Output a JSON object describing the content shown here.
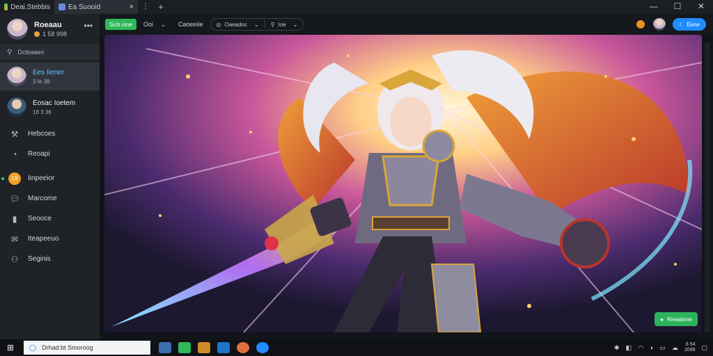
{
  "window": {
    "app_tab": "Deai.Stebbis",
    "active_tab": "Ea Suooid",
    "tab_close": "×",
    "new_tab": "+",
    "minimize": "—",
    "maximize": "☐",
    "close": "✕"
  },
  "sidebar": {
    "profile": {
      "name": "Roeaau",
      "sub": "1 58 998"
    },
    "more": "•••",
    "search_placeholder": "Dcteaaes",
    "friends": [
      {
        "name": "Ees Iiener",
        "sub": "3 Ie 38"
      },
      {
        "name": "Eosac Ioetem",
        "sub": "18 3 36"
      }
    ],
    "nav": [
      {
        "label": "Hebcoes",
        "icon": "hammer-icon"
      },
      {
        "label": "Reoapi",
        "icon": "bell-icon"
      },
      {
        "label": "Iinpeeior",
        "icon": "orange-badge-icon",
        "badge": "19"
      },
      {
        "label": "Marcome",
        "icon": "chat-icon"
      },
      {
        "label": "Seooce",
        "icon": "bookmark-icon"
      },
      {
        "label": "Iteapeeuo",
        "icon": "mail-icon"
      },
      {
        "label": "Seginis",
        "icon": "users-icon"
      }
    ]
  },
  "toolbar": {
    "primary_button": "Sicb ione",
    "dropdown1": "Ooi",
    "dropdown1_chevron": "⌄",
    "label2": "Caoeeiie",
    "pill_left": "Oaeadoc",
    "pill_right": "Ioe",
    "blue_button": "Eene"
  },
  "status_chip": "Rieaaione",
  "taskbar": {
    "search_placeholder": "Drhad:bt Smoroog",
    "clock_time": "6 54",
    "clock_date": "2099"
  },
  "colors": {
    "accent_green": "#2fb85a",
    "accent_blue": "#1f8cff",
    "sidebar_bg": "#1f2227",
    "selected_text": "#60c0ff"
  }
}
